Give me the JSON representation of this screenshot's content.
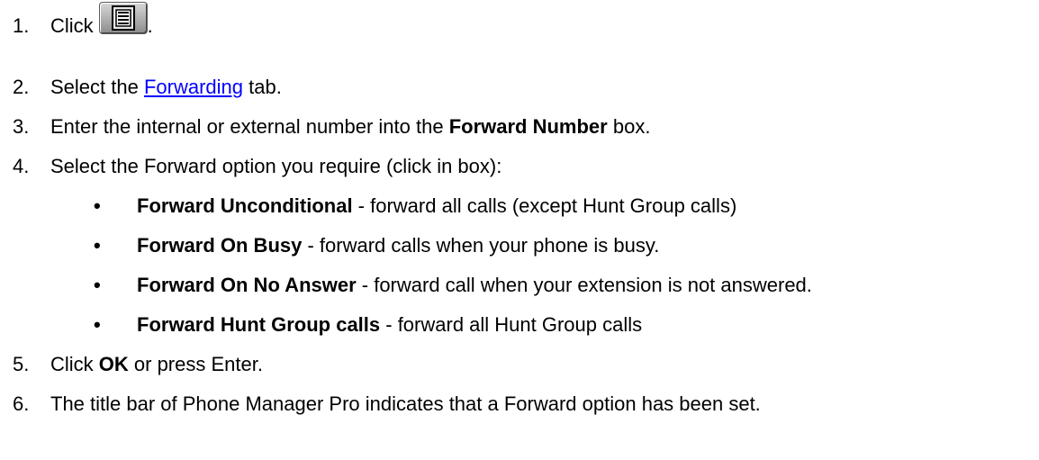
{
  "steps": [
    {
      "number": "1.",
      "prefix": "Click",
      "suffix": ".",
      "icon": "directory-list-icon"
    },
    {
      "number": "2.",
      "prefix": "Select the ",
      "link": "Forwarding",
      "suffix": " tab."
    },
    {
      "number": "3.",
      "prefix": "Enter the internal or external number into the ",
      "bold": "Forward Number",
      "suffix": " box."
    },
    {
      "number": "4.",
      "text": "Select the Forward option you require (click in box):"
    },
    {
      "number": "5.",
      "prefix": "Click ",
      "bold": "OK",
      "suffix": " or press Enter."
    },
    {
      "number": "6.",
      "text": "The title bar of Phone Manager Pro indicates that a Forward option has been set."
    }
  ],
  "options": [
    {
      "bullet": "•",
      "bold": "Forward Unconditional",
      "text": " - forward all calls (except Hunt Group calls)"
    },
    {
      "bullet": "•",
      "bold": "Forward On Busy",
      "text": " - forward calls when your phone is busy."
    },
    {
      "bullet": "•",
      "bold": "Forward On No Answer",
      "text": " - forward call when your extension is not answered."
    },
    {
      "bullet": "•",
      "bold": "Forward Hunt Group calls",
      "text": " - forward all Hunt Group calls"
    }
  ]
}
